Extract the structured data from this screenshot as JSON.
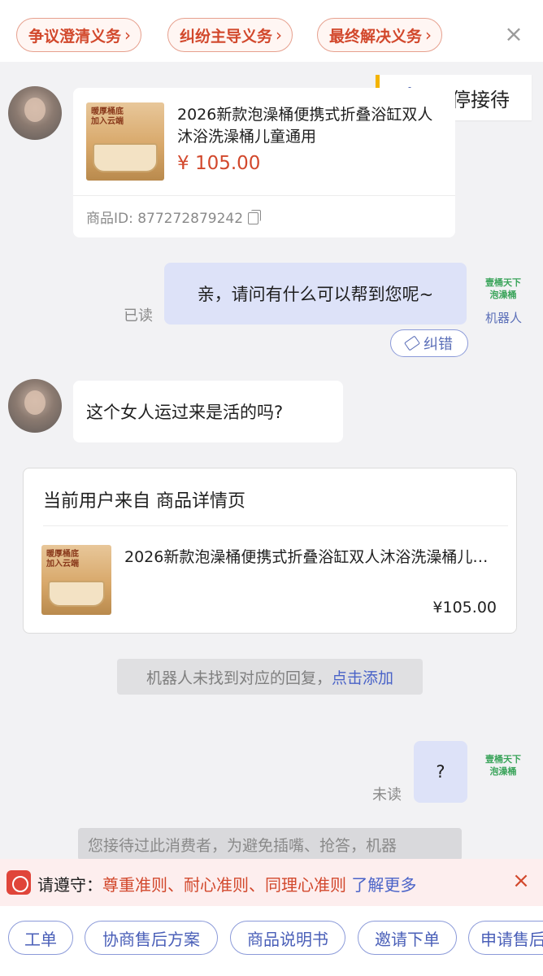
{
  "duty_chips": [
    {
      "label": "争议澄清义务"
    },
    {
      "label": "纠纷主导义务"
    },
    {
      "label": "最终解决义务"
    }
  ],
  "pause": {
    "label": "暂停接待"
  },
  "product_message": {
    "title": "2026新款泡澡桶便携式折叠浴缸双人沐浴洗澡桶儿童通用",
    "price": "¥ 105.00",
    "id_label": "商品ID: 877272879242",
    "thumb_text": "暖厚桶底 加入云端"
  },
  "agent_message": {
    "text": "亲，请问有什么可以帮到您呢~",
    "status": "已读",
    "bot_logo": "壹桶天下 泡澡桶",
    "bot_label": "机器人",
    "fix_label": "纠错"
  },
  "customer_message": {
    "text": "这个女人运过来是活的吗?"
  },
  "source_card": {
    "heading": "当前用户来自 商品详情页",
    "product_title": "2026新款泡澡桶便携式折叠浴缸双人沐浴洗澡桶儿童通用",
    "price": "¥105.00"
  },
  "system_note": {
    "text": "机器人未找到对应的回复，",
    "link": "点击添加"
  },
  "agent_message_2": {
    "text": "?",
    "status": "未读",
    "bot_logo": "壹桶天下 泡澡桶"
  },
  "policy_notice": {
    "text": "您接待过此消费者，为避免插嘴、抢答，机器"
  },
  "rules_bar": {
    "prefix": "请遵守：",
    "rules": "尊重准则、耐心准则、同理心准则",
    "link": "了解更多"
  },
  "quick_actions": [
    {
      "label": "工单"
    },
    {
      "label": "协商售后方案"
    },
    {
      "label": "商品说明书"
    },
    {
      "label": "邀请下单"
    },
    {
      "label": "申请售后"
    }
  ],
  "colors": {
    "accent_red": "#d2482c",
    "link_blue": "#4a63c8",
    "bubble_blue": "#dde2f8",
    "bot_green": "#3aa45a",
    "pause_yellow": "#f4b400"
  },
  "icons": [
    "chevron-right-icon",
    "close-icon",
    "robot-icon",
    "copy-icon",
    "eraser-icon",
    "shop-logo-icon"
  ]
}
